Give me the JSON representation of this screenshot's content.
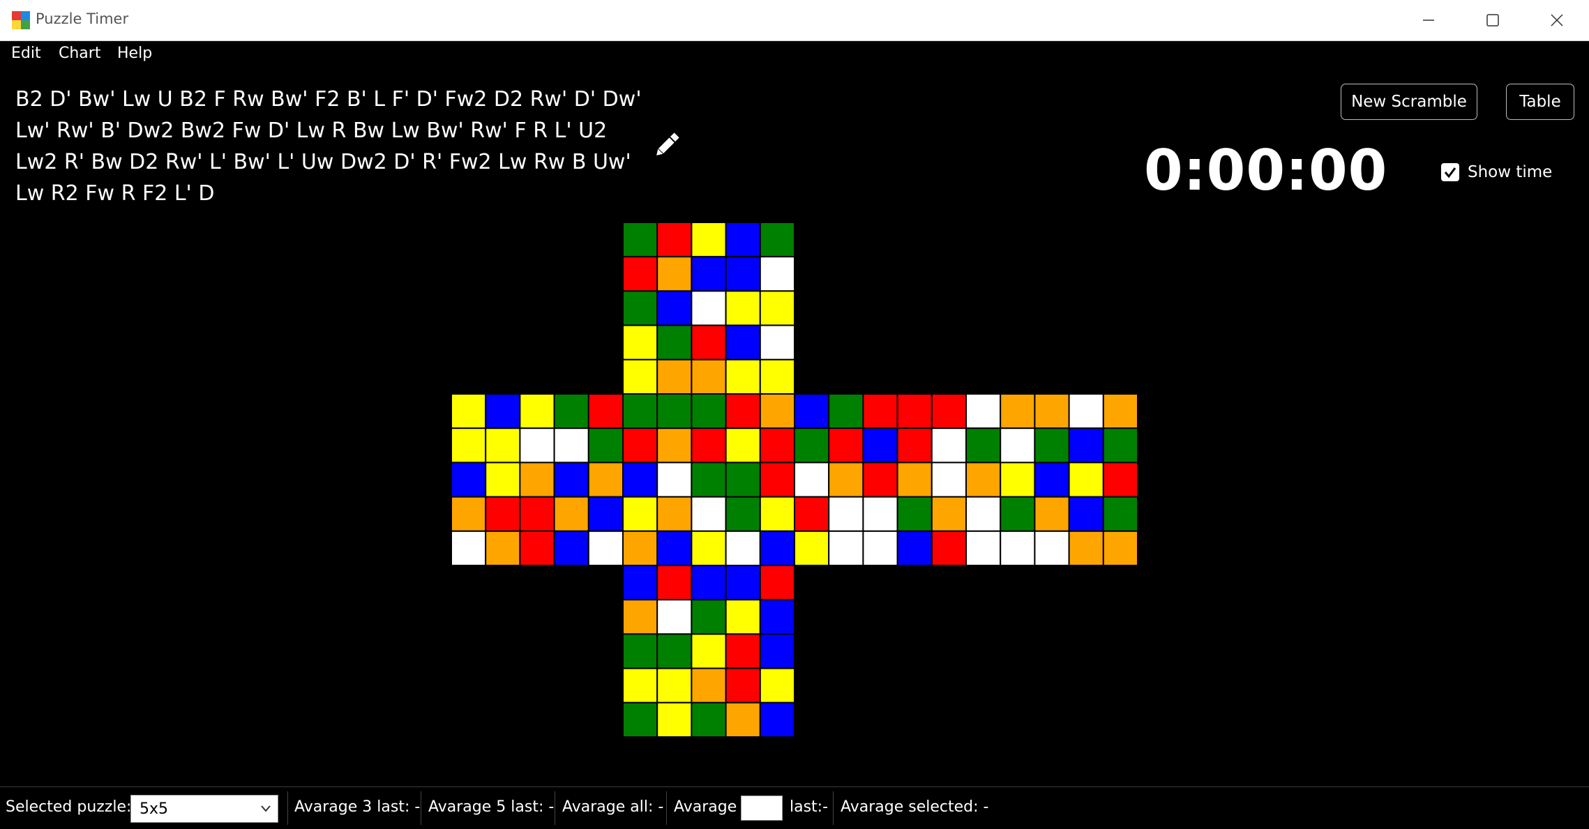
{
  "window": {
    "title": "Puzzle Timer"
  },
  "menu": {
    "edit": "Edit",
    "chart": "Chart",
    "help": "Help"
  },
  "scramble": {
    "text": "B2 D' Bw' Lw U B2 F Rw Bw' F2 B' L F' D' Fw2 D2 Rw' D' Dw' Lw' Rw' B' Dw2 Bw2 Fw D' Lw R Bw Lw Bw' Rw' F R L' U2 Lw2 R' Bw D2 Rw' L' Bw' L' Uw Dw2 D' R' Fw2 Lw Rw B Uw' Lw R2 Fw R F2 L' D"
  },
  "buttons": {
    "new_scramble": "New Scramble",
    "table": "Table"
  },
  "timer": {
    "display": "0:00:00"
  },
  "show_time": {
    "label": "Show time",
    "checked": true
  },
  "status": {
    "selected_puzzle_label": "Selected puzzle:",
    "selected_puzzle_value": "5x5",
    "avg3": "Avarage 3 last: -",
    "avg5": "Avarage 5 last: -",
    "avg_all": "Avarage all: -",
    "avg_custom_prefix": "Avarage",
    "avg_custom_suffix": "last:-",
    "avg_selected": "Avarage  selected: -"
  },
  "colors": {
    "G": "#008000",
    "R": "#ff0000",
    "Y": "#ffff00",
    "B": "#0000ff",
    "W": "#ffffff",
    "O": "#ffa500"
  },
  "cube": {
    "faces": {
      "up": [
        "GRYBG",
        "RO BBW",
        "GBWYY",
        "YGRBW",
        "YOOYY"
      ],
      "left": [
        "YBYGR",
        "YYWWG",
        "BYOBO",
        "ORROB",
        "WORBW"
      ],
      "front": [
        "GGGRO",
        "RORYR",
        "BWGGR",
        "YOWGY",
        "OBYWB"
      ],
      "right": [
        "BGRRR",
        "GRBRW",
        "WORO W",
        "RWWGO",
        "YWWBR"
      ],
      "back": [
        "WOOWO",
        "GWGBG",
        "OYBYR",
        "WGOBG",
        "WWWOO"
      ],
      "down": [
        "BRBBR",
        "OWGYB",
        "GGYRB",
        "YYORY",
        "GYGOB"
      ]
    }
  }
}
